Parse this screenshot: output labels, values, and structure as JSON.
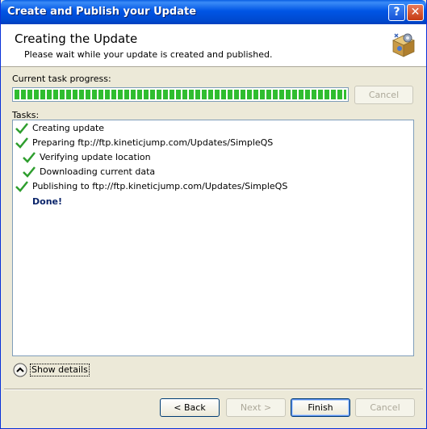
{
  "window": {
    "title": "Create and Publish your Update",
    "help_label": "?",
    "close_label": "✕"
  },
  "header": {
    "title": "Creating the Update",
    "subtitle": "Please wait while your update is created and published.",
    "icon": "package-icon"
  },
  "progress": {
    "label": "Current task progress:",
    "value": 1.0,
    "cancel_label": "Cancel"
  },
  "tasks": {
    "label": "Tasks:",
    "items": [
      {
        "text": "Creating update",
        "indent": 0
      },
      {
        "text": "Preparing ftp://ftp.kineticjump.com/Updates/SimpleQS",
        "indent": 0
      },
      {
        "text": "Verifying update location",
        "indent": 1
      },
      {
        "text": "Downloading current data",
        "indent": 1
      },
      {
        "text": "Publishing to ftp://ftp.kineticjump.com/Updates/SimpleQS",
        "indent": 0
      }
    ],
    "done": "Done!"
  },
  "details": {
    "label": "Show details"
  },
  "footer": {
    "back_label": "< Back",
    "next_label": "Next >",
    "finish_label": "Finish",
    "cancel_label": "Cancel"
  },
  "colors": {
    "titlebar": "#0055e5",
    "check": "#2e9e2e",
    "progress": "#2fbd2f",
    "done": "#0a246a"
  }
}
